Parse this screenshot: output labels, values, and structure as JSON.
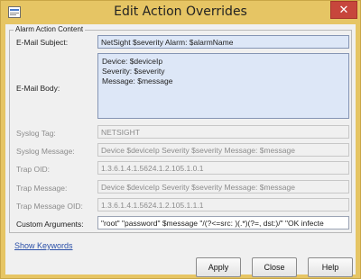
{
  "window": {
    "title": "Edit Action Overrides",
    "close_glyph": "✕",
    "titlebar_color": "#e6c564",
    "close_color": "#c7463c"
  },
  "group": {
    "legend": "Alarm Action Content"
  },
  "fields": {
    "email_subject": {
      "label": "E-Mail Subject:",
      "value": "NetSight $severity Alarm: $alarmName"
    },
    "email_body": {
      "label": "E-Mail Body:",
      "lines": [
        "Device: $deviceIp",
        "Severity: $severity",
        "Message: $message"
      ]
    },
    "syslog_tag": {
      "label": "Syslog Tag:",
      "value": "NETSIGHT"
    },
    "syslog_message": {
      "label": "Syslog Message:",
      "value": "Device $deviceIp Severity $severity Message: $message"
    },
    "trap_oid": {
      "label": "Trap OID:",
      "value": "1.3.6.1.4.1.5624.1.2.105.1.0.1"
    },
    "trap_message": {
      "label": "Trap Message:",
      "value": "Device $deviceIp Severity $severity Message: $message"
    },
    "trap_message_oid": {
      "label": "Trap Message OID:",
      "value": "1.3.6.1.4.1.5624.1.2.105.1.1.1"
    },
    "custom_arguments": {
      "label": "Custom Arguments:",
      "value": "\"root\" \"password\" $message \"/(?<=src: )(.*)(?=, dst:)/\" \"OK infecte"
    }
  },
  "footer": {
    "show_keywords": "Show Keywords",
    "apply_label": "Apply",
    "close_label": "Close",
    "help_label": "Help"
  }
}
